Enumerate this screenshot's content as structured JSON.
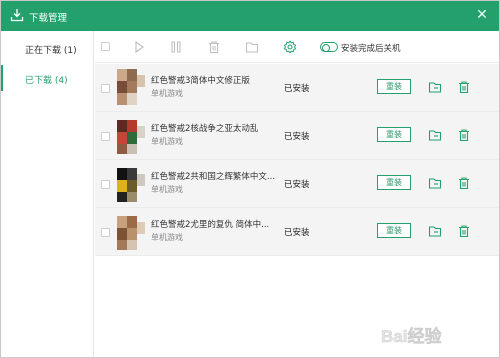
{
  "window": {
    "title": "下载管理",
    "close_glyph": "✕"
  },
  "sidebar": {
    "items": [
      {
        "label": "正在下载 (1)",
        "active": false
      },
      {
        "label": "已下载 (4)",
        "active": true
      }
    ]
  },
  "toolbar": {
    "icons": [
      "checkbox",
      "play-icon",
      "pause-icon",
      "delete-icon",
      "folder-icon",
      "settings-icon"
    ],
    "toggle_label": "安装完成后关机"
  },
  "downloads": [
    {
      "name": "红色警戒3简体中文修正版",
      "type": "单机游戏",
      "status": "已安装",
      "action": "重装"
    },
    {
      "name": "红色警戒2核战争之亚太动乱",
      "type": "单机游戏",
      "status": "已安装",
      "action": "重装"
    },
    {
      "name": "红色警戒2共和国之辉繁体中文...",
      "type": "单机游戏",
      "status": "已安装",
      "action": "重装"
    },
    {
      "name": "红色警戒2尤里的复仇  简体中...",
      "type": "单机游戏",
      "status": "已安装",
      "action": "重装"
    }
  ],
  "watermark": {
    "text": "Bai经验"
  },
  "colors": {
    "accent": "#23a06b",
    "row_bg": "#f4f4f4"
  }
}
